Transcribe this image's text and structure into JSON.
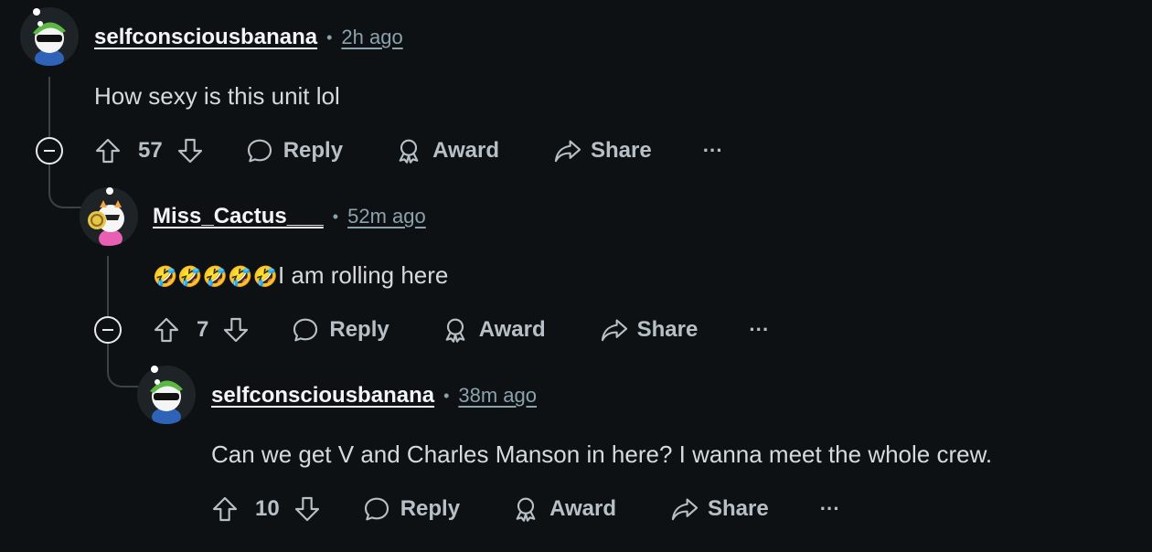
{
  "comments": [
    {
      "username": "selfconsciousbanana",
      "time": "2h ago",
      "body": "How sexy is this unit lol",
      "score": "57",
      "reply_label": "Reply",
      "award_label": "Award",
      "share_label": "Share",
      "more_label": "···"
    },
    {
      "username": "Miss_Cactus___",
      "time": "52m ago",
      "emoji": "🤣🤣🤣🤣🤣",
      "body": "I am rolling here",
      "score": "7",
      "reply_label": "Reply",
      "award_label": "Award",
      "share_label": "Share",
      "more_label": "···"
    },
    {
      "username": "selfconsciousbanana",
      "time": "38m ago",
      "body": "Can we get V and Charles Manson in here? I wanna meet the whole crew.",
      "score": "10",
      "reply_label": "Reply",
      "award_label": "Award",
      "share_label": "Share",
      "more_label": "···"
    }
  ],
  "separator": "•",
  "icons": [
    "upvote-icon",
    "downvote-icon",
    "comment-icon",
    "award-icon",
    "share-icon",
    "more-icon",
    "collapse-icon"
  ]
}
